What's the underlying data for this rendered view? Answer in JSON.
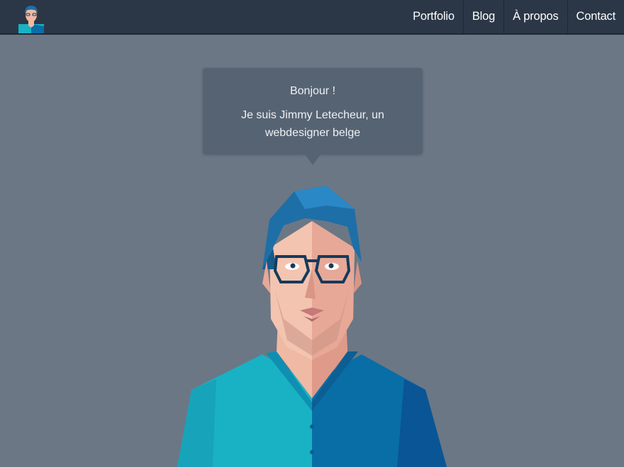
{
  "nav": {
    "logo_icon": "avatar-logo-icon",
    "links": [
      "Portfolio",
      "Blog",
      "À propos",
      "Contact"
    ]
  },
  "bubble": {
    "greeting": "Bonjour !",
    "intro": "Je suis Jimmy Letecheur, un webdesigner belge"
  },
  "colors": {
    "background": "#6b7785",
    "navbar": "#2b3646",
    "bubble": "#566373",
    "hair": "#1e6fa8",
    "shirt_light": "#19b2c4",
    "shirt_dark": "#0a6ea6",
    "skin": "#f0b9a4"
  },
  "illustration": {
    "icon": "avatar-illustration-icon"
  }
}
